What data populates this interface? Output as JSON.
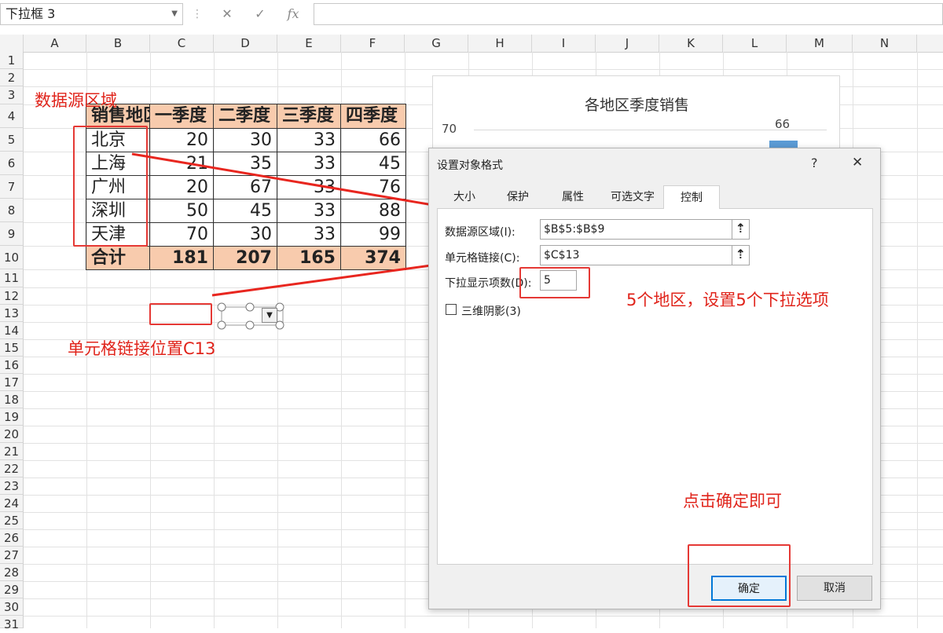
{
  "formula_bar": {
    "name_box": "下拉框 3",
    "cancel_symbol": "✕",
    "enter_symbol": "✓",
    "fx_symbol": "fx",
    "formula": ""
  },
  "columns": [
    "A",
    "B",
    "C",
    "D",
    "E",
    "F",
    "G",
    "H",
    "I",
    "J",
    "K",
    "L",
    "M",
    "N"
  ],
  "rows": [
    "1",
    "2",
    "3",
    "4",
    "5",
    "6",
    "7",
    "8",
    "9",
    "10",
    "11",
    "12",
    "13",
    "14",
    "15",
    "16",
    "17",
    "18",
    "19",
    "20",
    "21",
    "22",
    "23",
    "24",
    "25",
    "26",
    "27",
    "28",
    "29",
    "30",
    "31"
  ],
  "table": {
    "headers": [
      "销售地区",
      "一季度",
      "二季度",
      "三季度",
      "四季度"
    ],
    "rows": [
      [
        "北京",
        "20",
        "30",
        "33",
        "66"
      ],
      [
        "上海",
        "21",
        "35",
        "33",
        "45"
      ],
      [
        "广州",
        "20",
        "67",
        "33",
        "76"
      ],
      [
        "深圳",
        "50",
        "45",
        "33",
        "88"
      ],
      [
        "天津",
        "70",
        "30",
        "33",
        "99"
      ]
    ],
    "total": [
      "合计",
      "181",
      "207",
      "165",
      "374"
    ]
  },
  "annotations": {
    "data_source_area": "数据源区域",
    "cell_link_position": "单元格链接位置C13",
    "five_regions": "5个地区，设置5个下拉选项",
    "click_ok": "点击确定即可"
  },
  "chart": {
    "title": "各地区季度销售",
    "y_tick": "70",
    "data_label": "66",
    "bar_color": "#5b9bd5"
  },
  "dialog": {
    "title": "设置对象格式",
    "help": "?",
    "close": "✕",
    "tabs": [
      "大小",
      "保护",
      "属性",
      "可选文字",
      "控制"
    ],
    "active_tab": "控制",
    "fields": {
      "input_range_label": "数据源区域(I):",
      "input_range_value": "$B$5:$B$9",
      "cell_link_label": "单元格链接(C):",
      "cell_link_value": "$C$13",
      "drop_lines_label": "下拉显示项数(D):",
      "drop_lines_value": "5",
      "shading_label": "三维阴影(3)"
    },
    "ok": "确定",
    "cancel": "取消"
  }
}
